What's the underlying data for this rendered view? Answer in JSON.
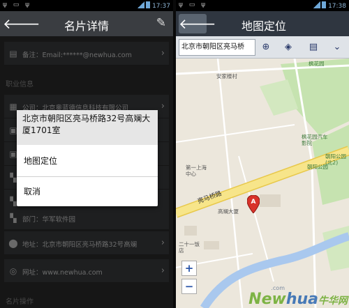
{
  "status": {
    "time": "17:37",
    "time_right": "17:38"
  },
  "left": {
    "title": "名片详情",
    "rows_top": [
      {
        "label": "备注：Email:******@newhua.com",
        "icon": "note-icon"
      }
    ],
    "section_job": "职业信息",
    "rows": [
      {
        "label": "公司：北京奥蓝德信息科技有限公司",
        "icon": "company-icon"
      },
      {
        "label": "部门：华军软件园",
        "icon": "department-icon"
      },
      {
        "label": "地址：北京市朝阳区亮马桥路32号高斓",
        "icon": "location-pin-icon"
      },
      {
        "label": "网址：www.newhua.com",
        "icon": "web-icon"
      }
    ],
    "section_ops": "名片操作",
    "dialog": {
      "address": "北京市朝阳区亮马桥路32号高斓大厦1701室",
      "option_map": "地图定位",
      "option_cancel": "取消"
    }
  },
  "right": {
    "title": "地图定位",
    "search_value": "北京市朝阳区亮马桥",
    "map_labels": {
      "anjiali": "安家楼村",
      "fenghuayuan": "枫花园",
      "fenghuayuan_car": "枫花园汽车影院",
      "chaoyang_park_n": "朝阳公园(北2)",
      "chaoyang_park_w": "朝阳公园",
      "diyi_shanghai": "第一上海中心",
      "liangmaqiao_rd": "亮马桥路",
      "gaolan": "高斓大厦",
      "fandian": "二十一饭店"
    },
    "marker_label": "A",
    "zoom_in": "+",
    "zoom_out": "−"
  },
  "watermark": {
    "brand_a": "New",
    "brand_b": "hua",
    "brand_c": "牛华网",
    "site": ".com"
  },
  "colors": {
    "titlebar": "#3a3d41",
    "map_bg": "#ece7dc",
    "road": "#f7e58a",
    "river": "#a9c8ee",
    "park": "#c6e3b0",
    "marker": "#d8322a"
  }
}
